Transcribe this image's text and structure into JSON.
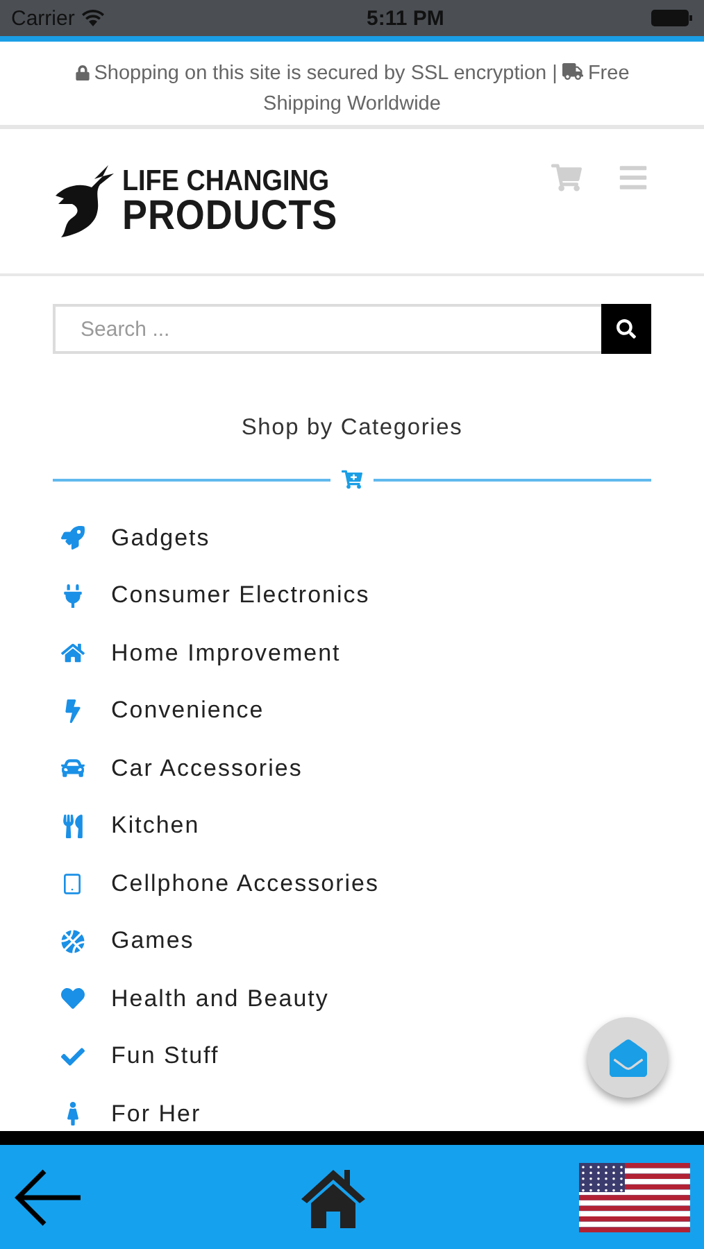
{
  "status_bar": {
    "carrier": "Carrier",
    "time": "5:11 PM"
  },
  "notice": {
    "security": "Shopping on this site is secured by SSL encryption |",
    "shipping_line_1": "Free",
    "shipping_line_2": "Shipping Worldwide"
  },
  "header": {
    "logo_line_1": "LIFE CHANGING",
    "logo_line_2": "PRODUCTS"
  },
  "search": {
    "placeholder": "Search ..."
  },
  "categories": {
    "title": "Shop by Categories",
    "items": [
      {
        "label": "Gadgets"
      },
      {
        "label": "Consumer Electronics"
      },
      {
        "label": "Home Improvement"
      },
      {
        "label": "Convenience"
      },
      {
        "label": "Car Accessories"
      },
      {
        "label": "Kitchen"
      },
      {
        "label": "Cellphone Accessories"
      },
      {
        "label": "Games"
      },
      {
        "label": "Health and Beauty"
      },
      {
        "label": "Fun Stuff"
      },
      {
        "label": "For Her"
      }
    ]
  }
}
